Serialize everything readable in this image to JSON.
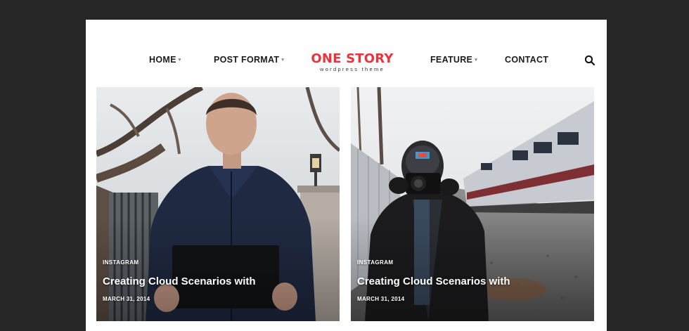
{
  "nav": {
    "items": [
      {
        "label": "HOME",
        "has_dropdown": true
      },
      {
        "label": "POST FORMAT",
        "has_dropdown": true
      },
      {
        "label": "FEATURE",
        "has_dropdown": true
      },
      {
        "label": "CONTACT",
        "has_dropdown": false
      }
    ],
    "caret": "▾",
    "search_icon": "search-icon"
  },
  "logo": {
    "title": "ONE STORY",
    "subtitle": "wordpress theme",
    "color": "#e8343a"
  },
  "posts": [
    {
      "category": "INSTAGRAM",
      "title": "Creating Cloud Scenarios with",
      "date": "MARCH 31, 2014",
      "image": "man-holding-tablet-photo"
    },
    {
      "category": "INSTAGRAM",
      "title": "Creating Cloud Scenarios with",
      "date": "MARCH 31, 2014",
      "image": "photographer-by-train-tracks-photo"
    }
  ],
  "colors": {
    "background": "#262626",
    "page": "#ffffff",
    "accent": "#e8343a",
    "text": "#1b1b1b"
  }
}
